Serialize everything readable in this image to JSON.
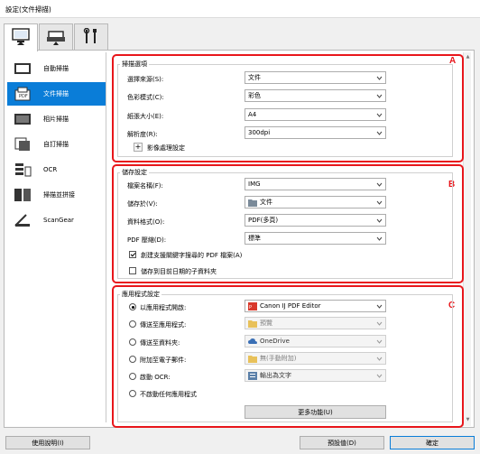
{
  "window": {
    "title": "設定(文件掃描)"
  },
  "top_tabs": [
    {
      "icon": "scan-from-computer-icon"
    },
    {
      "icon": "scan-from-operation-panel-icon"
    },
    {
      "icon": "general-settings-icon"
    }
  ],
  "sidebar": {
    "items": [
      {
        "label": "自動掃描",
        "icon": "auto-scan-icon"
      },
      {
        "label": "文件掃描",
        "icon": "document-scan-icon",
        "active": true
      },
      {
        "label": "相片掃描",
        "icon": "photo-scan-icon"
      },
      {
        "label": "自訂掃描",
        "icon": "custom-scan-icon"
      },
      {
        "label": "OCR",
        "icon": "ocr-icon"
      },
      {
        "label": "掃描並拼接",
        "icon": "scan-and-stitch-icon"
      },
      {
        "label": "ScanGear",
        "icon": "scangear-icon"
      }
    ]
  },
  "section_a": {
    "letter": "A",
    "title": "掃描選項",
    "rows": [
      {
        "label": "選擇來源(S):",
        "value": "文件"
      },
      {
        "label": "色彩模式(C):",
        "value": "彩色"
      },
      {
        "label": "紙張大小(E):",
        "value": "A4"
      },
      {
        "label": "解析度(R):",
        "value": "300dpi"
      }
    ],
    "image_processing_label": "影像處理設定"
  },
  "section_b": {
    "letter": "B",
    "title": "儲存設定",
    "rows": [
      {
        "label": "檔案名稱(F):",
        "value": "IMG"
      },
      {
        "label": "儲存於(V):",
        "value": "文件"
      },
      {
        "label": "資料格式(O):",
        "value": "PDF(多頁)"
      },
      {
        "label": "PDF 壓縮(D):",
        "value": "標準"
      }
    ],
    "check_searchable": "創建支援關鍵字搜尋的 PDF 檔案(A)",
    "check_subfolder": "儲存到目前日期的子資料夾"
  },
  "section_c": {
    "letter": "C",
    "title": "應用程式設定",
    "options": [
      {
        "label": "以應用程式開啟:",
        "value": "Canon IJ PDF Editor",
        "checked": true
      },
      {
        "label": "傳送至應用程式:",
        "value": "預覽",
        "checked": false
      },
      {
        "label": "傳送至資料夾:",
        "value": "OneDrive",
        "checked": false
      },
      {
        "label": "附加至電子郵件:",
        "value": "無(手動附加)",
        "checked": false
      },
      {
        "label": "啟動 OCR:",
        "value": "輸出為文字",
        "checked": false
      },
      {
        "label": "不啟動任何應用程式",
        "checked": false
      }
    ],
    "more_functions": "更多功能(U)"
  },
  "footer": {
    "help": "使用說明(I)",
    "defaults": "預設值(D)",
    "ok": "確定"
  },
  "colors": {
    "accent": "#0a7dd8",
    "frame": "#e8161b"
  }
}
